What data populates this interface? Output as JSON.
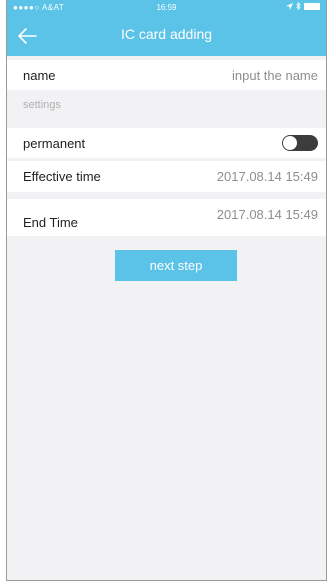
{
  "status_bar": {
    "carrier": "●●●●○ A&AT",
    "time": "16:59"
  },
  "nav": {
    "title": "IC card adding",
    "back_icon": "arrow-left-icon"
  },
  "form": {
    "name_label": "name",
    "name_placeholder": "input the name",
    "section_label": "settings",
    "permanent_label": "permanent",
    "permanent_on": false,
    "effective_label": "Effective time",
    "effective_value": "2017.08.14 15:49",
    "end_label": "End Time",
    "end_value": "2017.08.14 15:49"
  },
  "actions": {
    "next_label": "next step"
  },
  "colors": {
    "accent": "#5bc3e8",
    "toggle_off": "#3c3c3c"
  }
}
